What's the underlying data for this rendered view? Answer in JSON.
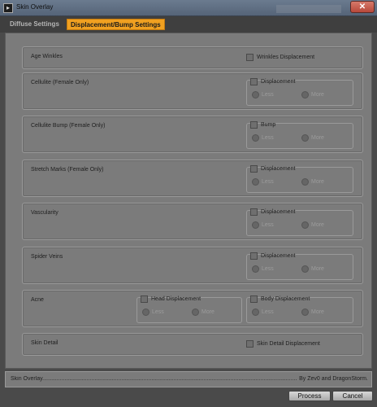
{
  "window": {
    "title": "Skin Overlay",
    "close_glyph": "✕",
    "app_glyph": "▸"
  },
  "tabs": [
    {
      "label": "Diffuse Settings",
      "active": false
    },
    {
      "label": "Displacement/Bump Settings",
      "active": true
    }
  ],
  "groups": {
    "age_wrinkles": {
      "label": "Age Winkles",
      "checkbox": "Wrinkles Displacement"
    },
    "cellulite": {
      "label": "Cellulite (Female Only)",
      "checkbox": "Displacement",
      "less": "Less",
      "more": "More"
    },
    "cellulite_bump": {
      "label": "Cellulite Bump (Female Only)",
      "checkbox": "Bump",
      "less": "Less",
      "more": "More"
    },
    "stretch_marks": {
      "label": "Stretch Marks (Female Only)",
      "checkbox": "Displacement",
      "less": "Less",
      "more": "More"
    },
    "vascularity": {
      "label": "Vascularity",
      "checkbox": "Displacement",
      "less": "Less",
      "more": "More"
    },
    "spider_veins": {
      "label": "Spider Veins",
      "checkbox": "Displacement",
      "less": "Less",
      "more": "More"
    },
    "acne": {
      "label": "Acne",
      "head_checkbox": "Head Displacement",
      "head_less": "Less",
      "head_more": "More",
      "body_checkbox": "Body Displacement",
      "body_less": "Less",
      "body_more": "More"
    },
    "skin_detail": {
      "label": "Skin Detail",
      "checkbox": "Skin Detail Displacement"
    }
  },
  "status": {
    "left": "Skin Overlay..............................................................................................................................................................................................................................",
    "right": "By Zev0 and DragonStorm"
  },
  "buttons": {
    "process": "Process",
    "cancel": "Cancel"
  }
}
